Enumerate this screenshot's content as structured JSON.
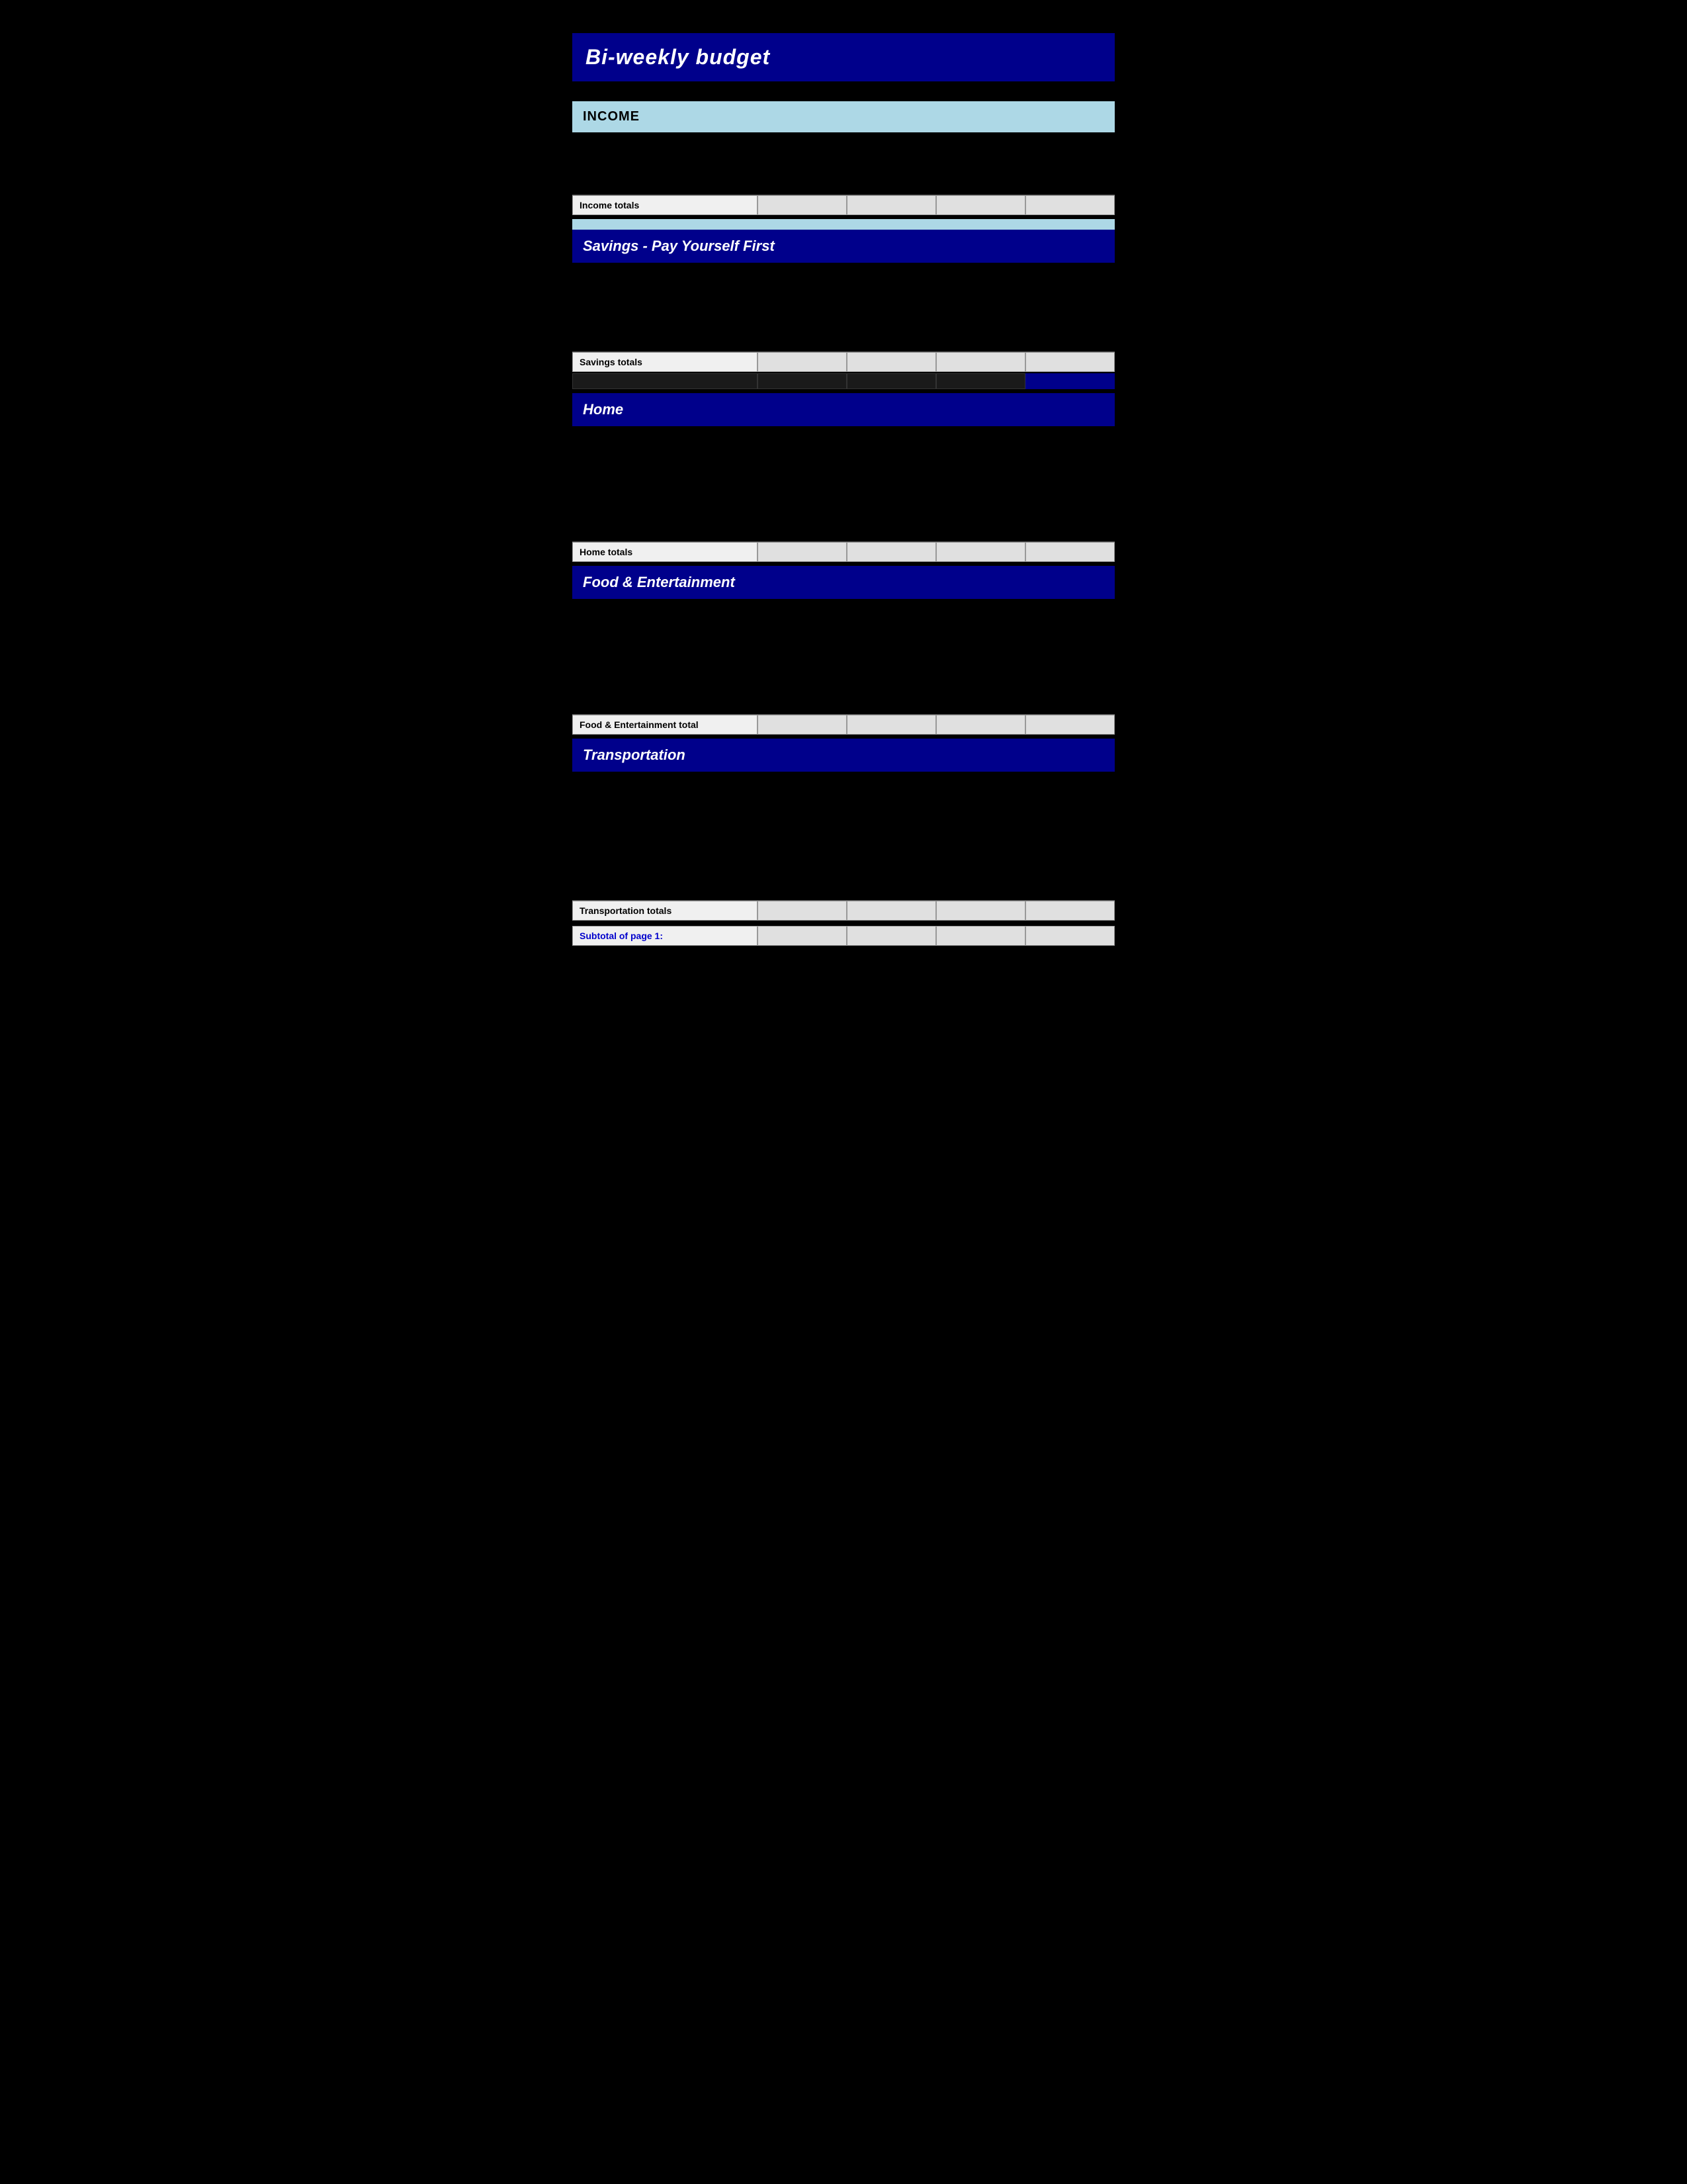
{
  "title": "Bi-weekly  budget",
  "sections": {
    "income": {
      "header": "Income",
      "totals_label": "Income totals"
    },
    "savings": {
      "header": "Savings - Pay Yourself First",
      "totals_label": "Savings totals"
    },
    "home": {
      "header": "Home",
      "totals_label": "Home totals"
    },
    "food": {
      "header": "Food & Entertainment",
      "totals_label": "Food & Entertainment total"
    },
    "transportation": {
      "header": "Transportation",
      "totals_label": "Transportation totals"
    },
    "subtotal": {
      "label": "Subtotal of page 1:"
    }
  }
}
